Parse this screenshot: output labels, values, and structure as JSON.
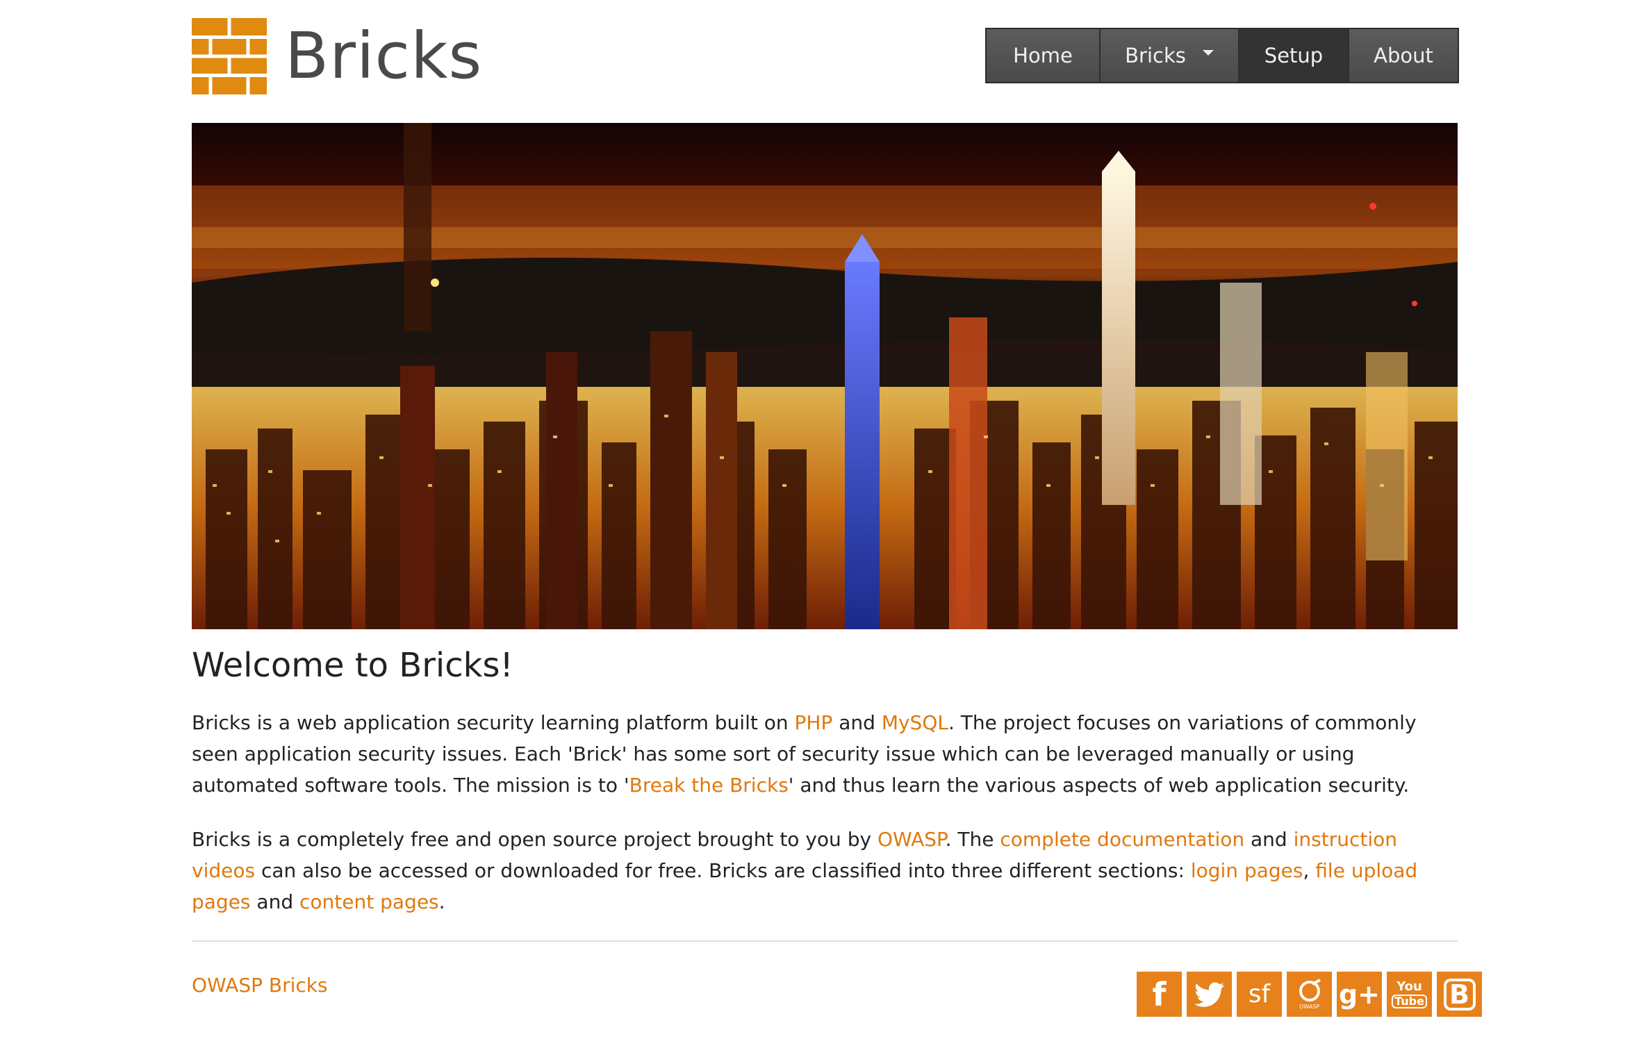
{
  "header": {
    "logo_text": "Bricks",
    "nav": [
      {
        "label": "Home"
      },
      {
        "label": "Bricks"
      },
      {
        "label": "Setup"
      },
      {
        "label": "About"
      }
    ]
  },
  "colors": {
    "accent": "#e0780e",
    "logo_orange": "#e08a10",
    "nav_bg": "#4f4f4f",
    "nav_active": "#333333"
  },
  "main": {
    "title": "Welcome to Bricks!",
    "p1": {
      "t1": "Bricks is a web application security learning platform built on ",
      "link_php": "PHP",
      "t2": " and ",
      "link_mysql": "MySQL",
      "t3": ". The project focuses on variations of commonly seen application security issues. Each 'Brick' has some sort of security issue which can be leveraged manually or using automated software tools. The mission is to '",
      "link_break": "Break the Bricks",
      "t4": "' and thus learn the various aspects of web application security."
    },
    "p2": {
      "t1": "Bricks is a completely free and open source project brought to you by ",
      "link_owasp": "OWASP",
      "t2": ". The ",
      "link_docs": "complete documentation",
      "t3": " and ",
      "link_videos": "instruction videos",
      "t4": " can also be accessed or downloaded for free. Bricks are classified into three different sections: ",
      "link_login": "login pages",
      "t5": ", ",
      "link_upload": "file upload pages",
      "t6": " and ",
      "link_content": "content pages",
      "t7": "."
    }
  },
  "footer": {
    "link": "OWASP Bricks",
    "social": [
      {
        "icon": "facebook-icon",
        "glyph": "f"
      },
      {
        "icon": "twitter-icon",
        "glyph": ""
      },
      {
        "icon": "sourceforge-icon",
        "glyph": "sf"
      },
      {
        "icon": "owasp-icon",
        "glyph": "OWASP"
      },
      {
        "icon": "google-plus-icon",
        "glyph": "g+"
      },
      {
        "icon": "youtube-icon",
        "glyph_top": "You",
        "glyph_bottom": "Tube"
      },
      {
        "icon": "blogger-icon",
        "glyph": "B"
      }
    ]
  }
}
